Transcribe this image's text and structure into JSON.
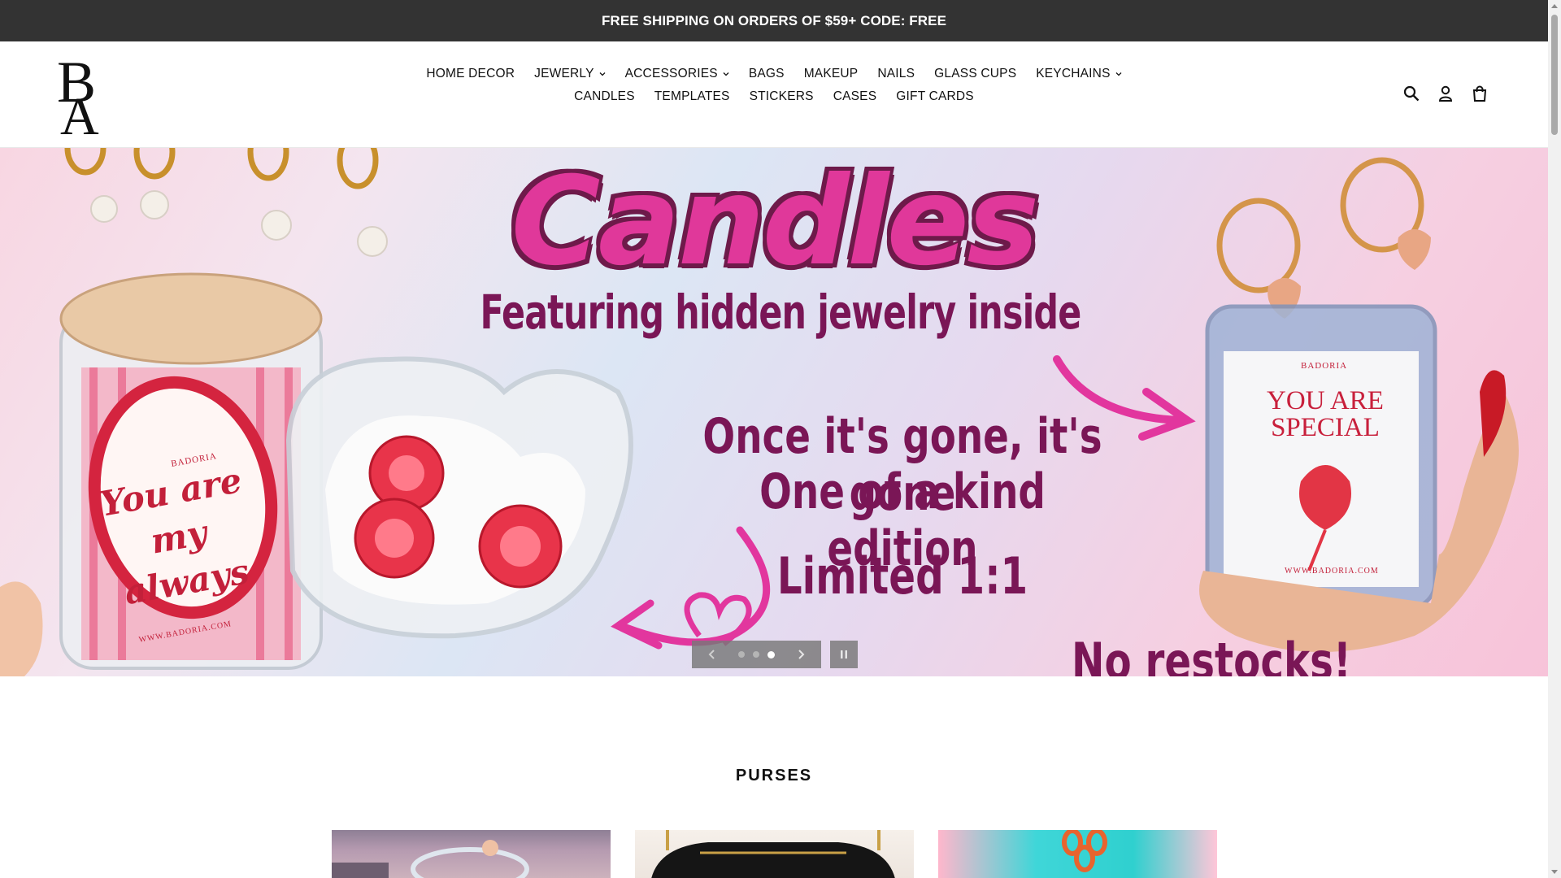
{
  "announcement": {
    "text": "FREE SHIPPING ON ORDERS OF $59+ CODE: FREE"
  },
  "header": {
    "logo_text": "BA",
    "nav_row1": [
      {
        "label": "HOME DECOR",
        "dropdown": false
      },
      {
        "label": "JEWERLY",
        "dropdown": true
      },
      {
        "label": "ACCESSORIES",
        "dropdown": true
      },
      {
        "label": "BAGS",
        "dropdown": false
      },
      {
        "label": "MAKEUP",
        "dropdown": false
      },
      {
        "label": "NAILS",
        "dropdown": false
      },
      {
        "label": "GLASS CUPS",
        "dropdown": false
      },
      {
        "label": "KEYCHAINS",
        "dropdown": true
      }
    ],
    "nav_row2": [
      {
        "label": "CANDLES",
        "dropdown": false
      },
      {
        "label": "TEMPLATES",
        "dropdown": false
      },
      {
        "label": "STICKERS",
        "dropdown": false
      },
      {
        "label": "CASES",
        "dropdown": false
      },
      {
        "label": "GIFT CARDS",
        "dropdown": false
      }
    ],
    "icons": [
      "search-icon",
      "account-icon",
      "cart-icon"
    ]
  },
  "hero": {
    "title": "Candles",
    "subtitle": "Featuring hidden jewelry inside",
    "line1": "Once it's gone, it's gone",
    "line2": "One of a kind edition",
    "line3": "Limited 1:1",
    "line4": "No restocks!",
    "jar_left_brand": "BADORIA",
    "jar_left_text": "You are my always",
    "jar_left_footer": "WWW.BADORIA.COM",
    "jar_right_brand": "BADORIA",
    "jar_right_text": "YOU ARE SPECIAL",
    "jar_right_footer": "WWW.BADORIA.COM",
    "slides_total": 3,
    "active_slide": 3
  },
  "section": {
    "title": "PURSES"
  },
  "colors": {
    "announcement_bg": "#333333",
    "hero_pink": "#e0389a",
    "hero_text": "#7a1656"
  }
}
